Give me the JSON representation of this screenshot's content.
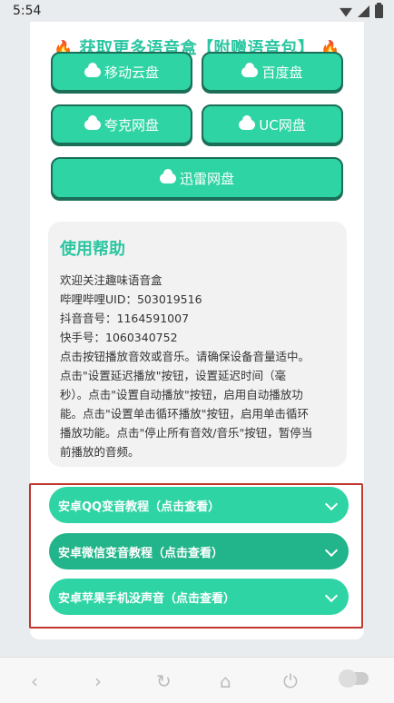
{
  "status": {
    "time": "5:54"
  },
  "header": {
    "fire_left": "🔥",
    "title": "获取更多语音盒【附赠语音包】",
    "fire_right": "🔥"
  },
  "downloads": [
    {
      "label": "移动云盘"
    },
    {
      "label": "百度盘"
    },
    {
      "label": "夸克网盘"
    },
    {
      "label": "UC网盘"
    },
    {
      "label": "迅雷网盘"
    }
  ],
  "help": {
    "title": "使用帮助",
    "lines": [
      "欢迎关注趣味语音盒",
      "哔哩哔哩UID：503019516",
      "抖音音号：1164591007",
      "快手号：1060340752",
      "点击按钮播放音效或音乐。请确保设备音量适中。",
      "点击\"设置延迟播放\"按钮，设置延迟时间（毫",
      "秒）。点击\"设置自动播放\"按钮，启用自动播放功",
      "能。点击\"设置单击循环播放\"按钮，启用单击循环",
      "播放功能。点击\"停止所有音效/音乐\"按钮，暂停当",
      "前播放的音频。"
    ]
  },
  "tutorials": [
    {
      "label": "安卓QQ变音教程（点击查看）"
    },
    {
      "label": "安卓微信变音教程（点击查看）"
    },
    {
      "label": "安卓苹果手机没声音（点击查看）"
    }
  ],
  "colors": {
    "accent": "#2fd4a4",
    "accent_dark": "#22b48a",
    "title": "#2bc6a1",
    "highlight": "#c0362d"
  }
}
